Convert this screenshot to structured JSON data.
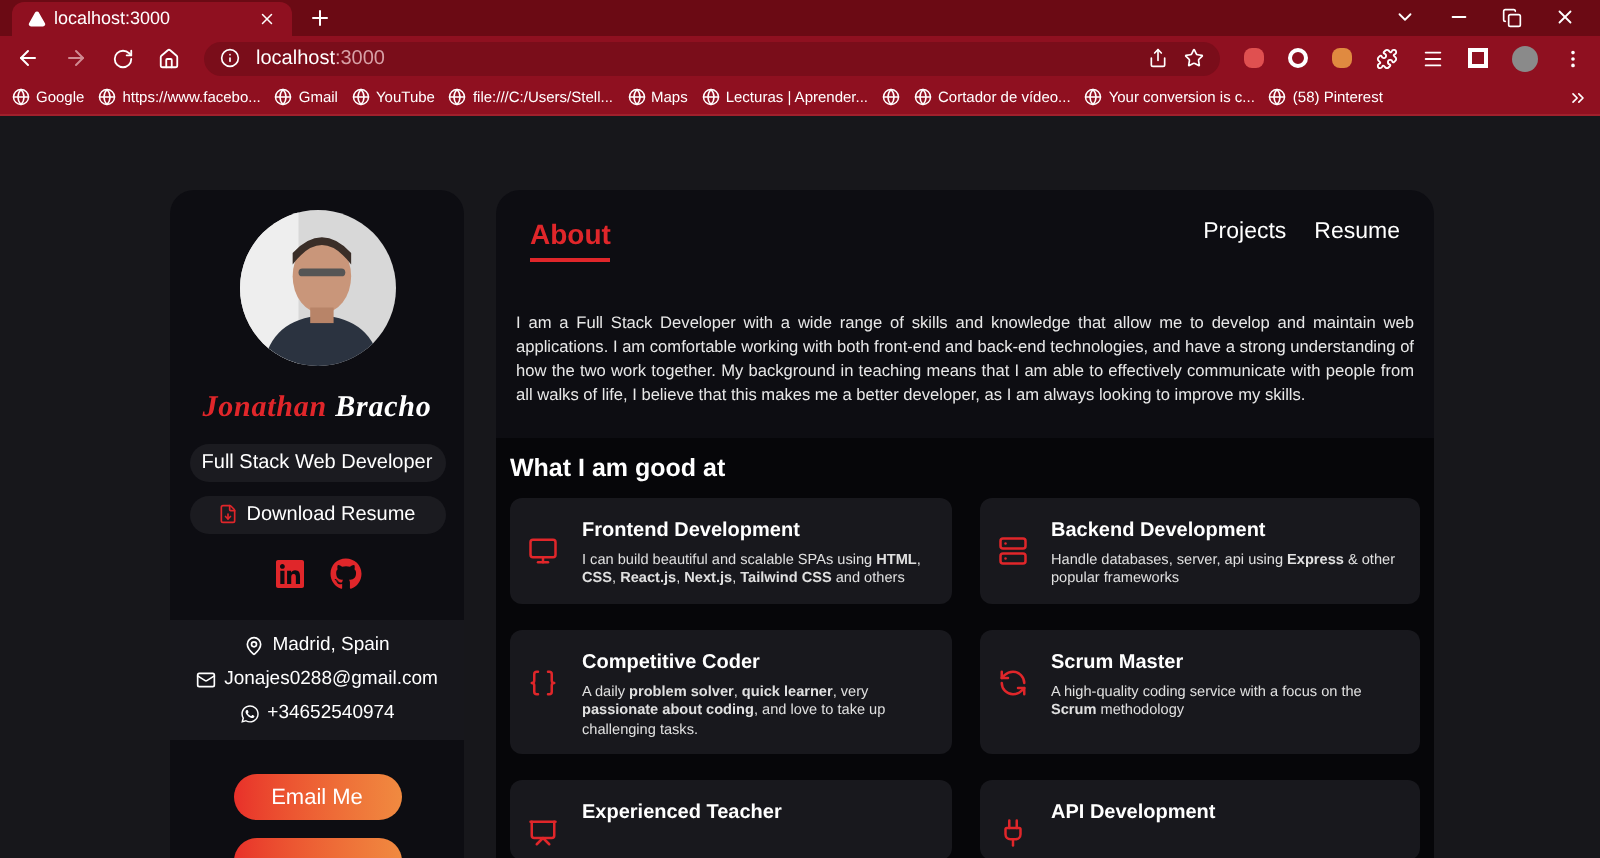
{
  "browser": {
    "tab_title": "localhost:3000",
    "url_host": "localhost",
    "url_port": ":3000",
    "bookmarks": [
      {
        "kind": "link",
        "label": "Google"
      },
      {
        "kind": "link",
        "label": "https://www.facebo..."
      },
      {
        "kind": "link",
        "label": "Gmail"
      },
      {
        "kind": "link",
        "label": "YouTube"
      },
      {
        "kind": "link",
        "label": "file:///C:/Users/Stell..."
      },
      {
        "kind": "link",
        "label": "Maps"
      },
      {
        "kind": "link",
        "label": "Lecturas | Aprender..."
      },
      {
        "kind": "icon"
      },
      {
        "kind": "link",
        "label": "Cortador de vídeo..."
      },
      {
        "kind": "link",
        "label": "Your conversion is c..."
      },
      {
        "kind": "link",
        "label": "(58) Pinterest"
      }
    ]
  },
  "profile": {
    "first_name": "Jonathan",
    "last_name": "Bracho",
    "role": "Full Stack Web Developer",
    "download": "Download Resume",
    "location": "Madrid, Spain",
    "email": "Jonajes0288@gmail.com",
    "phone": "+34652540974",
    "email_button": "Email Me"
  },
  "nav": [
    {
      "label": "About",
      "selected": true
    },
    {
      "label": "Projects",
      "selected": false
    },
    {
      "label": "Resume",
      "selected": false
    }
  ],
  "about": "I am a Full Stack Developer with a wide range of skills and knowledge that allow me to develop and maintain web applications. I am comfortable working with both front-end and back-end technologies, and have a strong understanding of how the two work together. My background in teaching means that I am able to effectively communicate with people from all walks of life, I believe that this makes me a better developer, as I am always looking to improve my skills.",
  "skills_title": "What I am good at",
  "skills": [
    {
      "kind": "monitor",
      "title": "Frontend Development",
      "text": "I can build beautiful and scalable SPAs using **HTML**, **CSS**, **React.js**, **Next.js**, **Tailwind CSS** and others"
    },
    {
      "kind": "server",
      "title": "Backend Development",
      "text": "Handle databases, server, api using **Express** & other popular frameworks"
    },
    {
      "kind": "code",
      "title": "Competitive Coder",
      "text": "A daily **problem solver**, **quick learner**, very **passionate about coding**, and love to take up challenging tasks."
    },
    {
      "kind": "cycle",
      "title": "Scrum Master",
      "text": "A high-quality coding service with a focus on the **Scrum** methodology"
    },
    {
      "kind": "teacher",
      "title": "Experienced Teacher"
    },
    {
      "kind": "api",
      "title": "API Development"
    }
  ]
}
